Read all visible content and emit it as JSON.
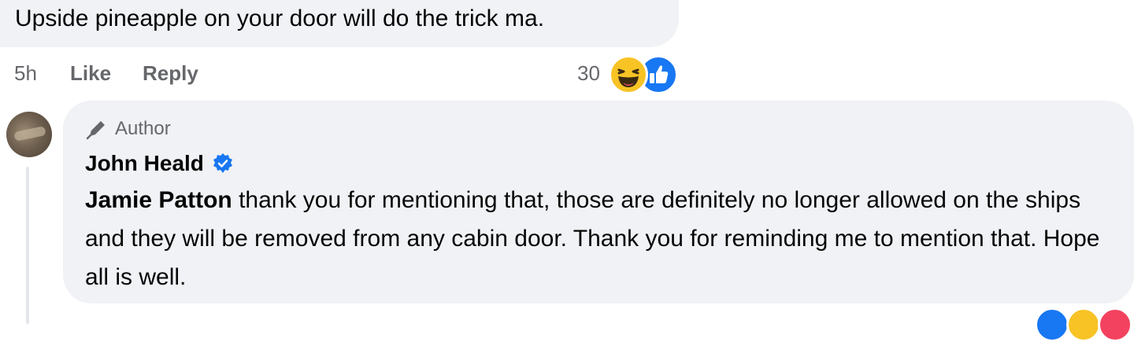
{
  "comment": {
    "text": "Upside pineapple on your door will do the trick ma.",
    "time": "5h",
    "like_label": "Like",
    "reply_label": "Reply",
    "reaction_count": "30",
    "reaction_icons": [
      "haha-icon",
      "like-icon"
    ]
  },
  "reply": {
    "badge_label": "Author",
    "badge_icon": "pen-icon",
    "author_name": "John Heald",
    "verified": true,
    "mention": "Jamie Patton",
    "text": " thank you for mentioning that, those are definitely no longer allowed on the ships and they will be removed from any cabin door. Thank you for reminding me to mention that. Hope all is well."
  },
  "colors": {
    "bubble": "#f0f2f5",
    "secondary_text": "#65676b",
    "brand_blue": "#1877f2",
    "haha_yellow": "#f7c325"
  }
}
